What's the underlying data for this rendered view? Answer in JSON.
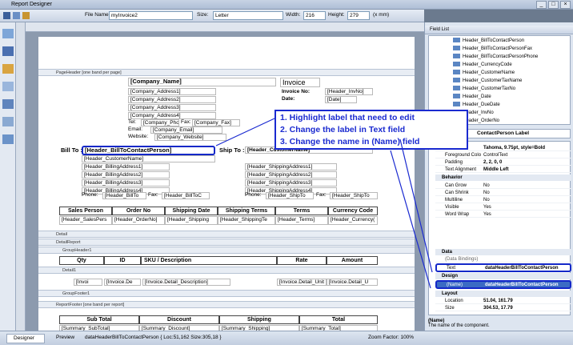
{
  "window": {
    "title": "Report Designer"
  },
  "toolbar": {
    "file_name_label": "File Name:",
    "file_name": "myInvoice2",
    "size_label": "Size:",
    "size": "Letter",
    "width_label": "Width:",
    "width": "216",
    "height_label": "Height:",
    "height": "279",
    "units": "(x mm)"
  },
  "page_header": {
    "band": "PageHeader [one band per page]",
    "company_name": "[Company_Name]",
    "address1": "[Company_Address1]",
    "address2": "[Company_Address2]",
    "address3": "[Company_Address3]",
    "address4": "[Company_Address4]",
    "tel_label": "Tel:",
    "tel": "[Company_Phon",
    "fax_label": "Fax:",
    "fax": "[Company_Fax]",
    "email_label": "Email:",
    "email": "[Company_Email]",
    "website_label": "Website:",
    "website": "[Company_Website]",
    "invoice_title": "Invoice",
    "invoice_no_label": "Invoice No:",
    "invoice_no": "[Header_InvNo]",
    "date_label": "Date:",
    "date": "[Date]",
    "bill_to_label": "Bill To :",
    "bill_to_person": "[Header_BillToContactPerson]",
    "bill_to_customer": "[Header_CustomerName]",
    "bill1": "[Header_BillingAddress1]",
    "bill2": "[Header_BillingAddress2]",
    "bill3": "[Header_BillingAddress3]",
    "bill4": "[Header_BillingAddress4]",
    "bill_phone_label": "Phone:",
    "bill_phone": "[Header_BillTo",
    "bill_fax_label": "Fax:",
    "bill_fax": "[Header_BillToC",
    "ship_to_label": "Ship To :",
    "ship_customer": "[Header_CustomerName]",
    "ship1": "[Header_ShippingAddress1]",
    "ship2": "[Header_ShippingAddress2]",
    "ship3": "[Header_ShippingAddress3]",
    "ship4": "[Header_ShippingAddress4]",
    "ship_phone_label": "Phone:",
    "ship_phone": "[Header_ShipTo",
    "ship_fax_label": "Fax:",
    "ship_fax": "[Header_ShipTo",
    "cols": [
      "Sales Person",
      "Order No",
      "Shipping Date",
      "Shipping Terms",
      "Terms",
      "Currency Code"
    ],
    "vals": [
      "[Header_SalesPers",
      "[Header_OrderNo]",
      "[Header_Shipping",
      "[Header_ShippingTe",
      "[Header_Terms]",
      "[Header_Currency("
    ]
  },
  "bands": {
    "detail": "Detail",
    "detail_report": "DetailReport",
    "group_header": "GroupHeader1",
    "detail1": "Detail1",
    "group_footer": "GroupFooter1",
    "report_footer": "ReportFooter [one band per report]"
  },
  "detail_table": {
    "cols": [
      "Qty",
      "ID",
      "SKU / Description",
      "Rate",
      "Amount"
    ],
    "vals": [
      "[Invoi",
      "[Invoice.De",
      "[Invoice.Detail_Description]",
      "[Invoice.Detail_Unit",
      "[Invoice.Detail_U"
    ]
  },
  "footer_table": {
    "cols": [
      "Sub Total",
      "Discount",
      "Shipping",
      "Total"
    ],
    "vals": [
      "[Summary_SubTotal]",
      "[Summary_Discount]",
      "[Summary_Shipping]",
      "[Summary_Total]"
    ]
  },
  "instructions": [
    "1. Highlight label that need to edit",
    "2. Change the label in Text field",
    "3. Change the name in (Name) field"
  ],
  "field_list": {
    "title": "Field List",
    "items": [
      "Header_BillToContactPerson",
      "Header_BillToContactPersonFax",
      "Header_BillToContactPersonPhone",
      "Header_CurrencyCode",
      "Header_CustomerName",
      "Header_CustomerTaxName",
      "Header_CustomerTaxNo",
      "Header_Date",
      "Header_DueDate",
      "Header_InvNo",
      "Header_OrderNo"
    ]
  },
  "properties": {
    "selector": "ContactPerson   Label",
    "rows": [
      {
        "k": "Font",
        "v": "Tahoma, 9.75pt, style=Bold"
      },
      {
        "k": "Foreground Colo",
        "v": "ControlText"
      },
      {
        "k": "Padding",
        "v": "2, 2, 0, 0"
      },
      {
        "k": "Text Alignment",
        "v": "Middle Left"
      }
    ],
    "behavior": "Behavior",
    "brows": [
      {
        "k": "Can Grow",
        "v": "No"
      },
      {
        "k": "Can Shrink",
        "v": "No"
      },
      {
        "k": "Multiline",
        "v": "No"
      },
      {
        "k": "Visible",
        "v": "Yes"
      },
      {
        "k": "Word Wrap",
        "v": "Yes"
      }
    ],
    "data": "Data",
    "data_bindings": "(Data Bindings)",
    "text_key": "Text",
    "text_val": "dataHeaderBillToContactPerson",
    "design": "Design",
    "name_key": "(Name)",
    "name_val": "dataHeaderBillToContactPerson",
    "layout": "Layout",
    "loc_key": "Location",
    "loc_val": "51.04, 161.79",
    "size_key": "Size",
    "size_val": "304.53, 17.79",
    "desc_title": "(Name)",
    "desc": "The name of the component."
  },
  "status": {
    "designer": "Designer",
    "preview": "Preview",
    "info": "dataHeaderBillToContactPerson { Loc:51,162 Size:305,18 }",
    "zoom": "Zoom Factor: 100%"
  }
}
